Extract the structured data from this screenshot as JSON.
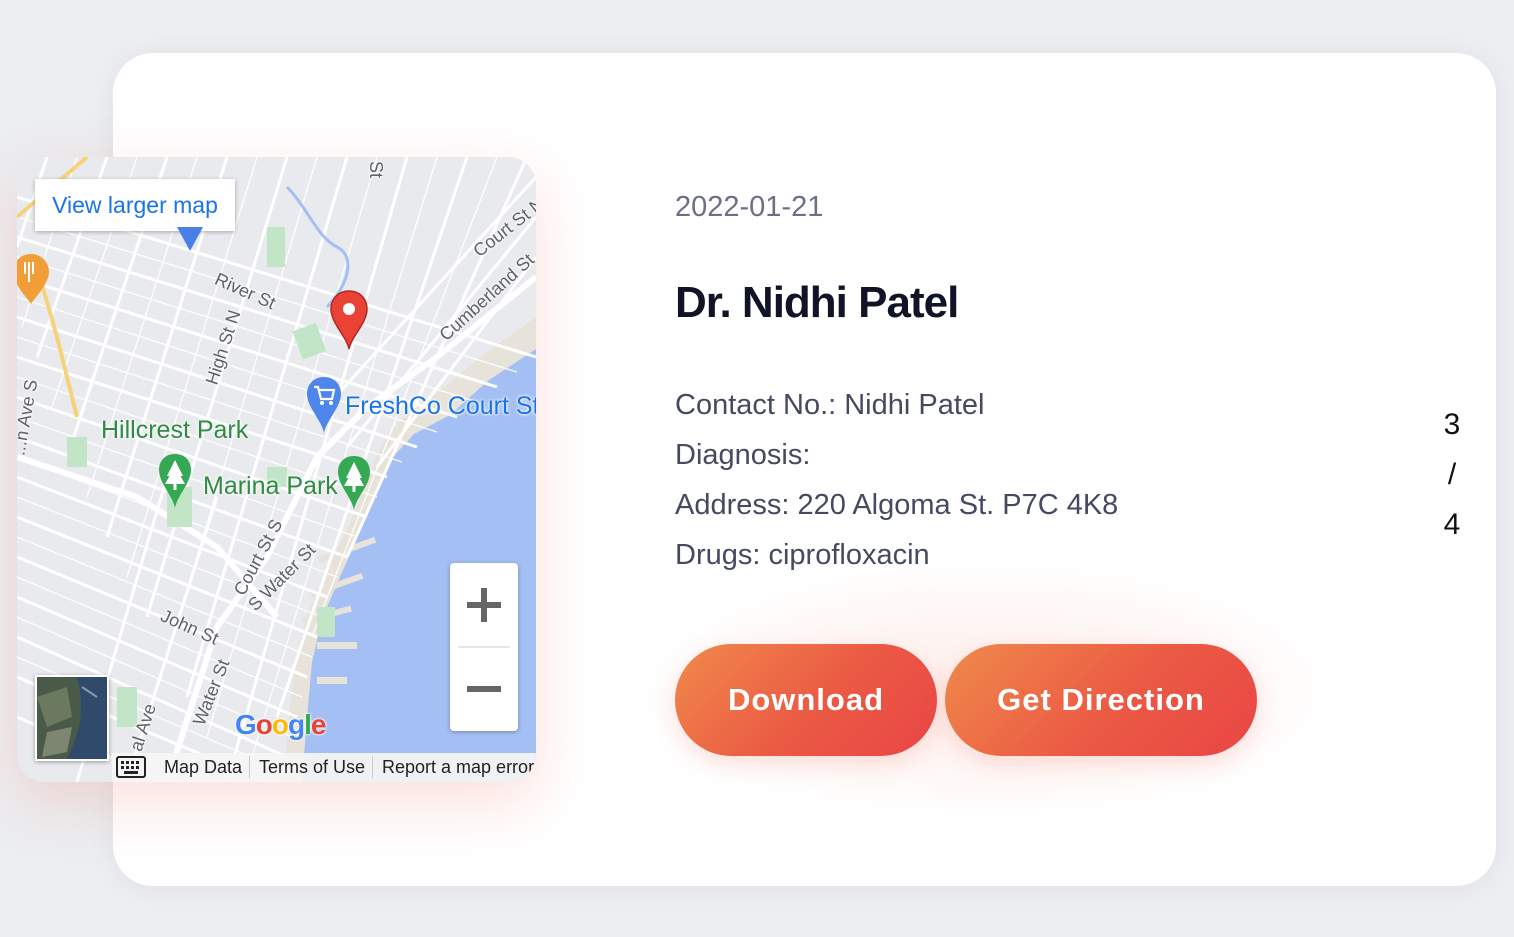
{
  "map": {
    "view_larger": "View larger map",
    "labels": {
      "hillcrest_park": "Hillcrest Park",
      "marina_park": "Marina Park",
      "freshco": "FreshCo Court Str",
      "river_st": "River St",
      "high_st_n": "High St N",
      "court_st_n": "Court St N",
      "cumberland_st": "Cumberland St",
      "court_st_s": "Court St S",
      "s_water_st": "S Water St",
      "john_st": "John St",
      "water_st": "Water St",
      "ave_s": "...n Ave S",
      "al_ave": "al Ave",
      "st_top": "St"
    },
    "google": "Google",
    "footer": {
      "map_data": "Map Data",
      "terms": "Terms of Use",
      "report": "Report a map error"
    }
  },
  "record": {
    "date": "2022-01-21",
    "doctor": "Dr. Nidhi Patel",
    "contact": "Contact No.: Nidhi Patel",
    "diagnosis": "Diagnosis:",
    "address": "Address: 220 Algoma St. P7C 4K8",
    "drugs": "Drugs: ciprofloxacin"
  },
  "actions": {
    "download": "Download",
    "direction": "Get Direction"
  },
  "pager": {
    "current": "3",
    "sep": "/",
    "total": "4"
  },
  "colors": {
    "accent_start": "#f08a4b",
    "accent_end": "#e94545",
    "park_green": "#2e8b42",
    "water_blue": "#a4bff3"
  }
}
